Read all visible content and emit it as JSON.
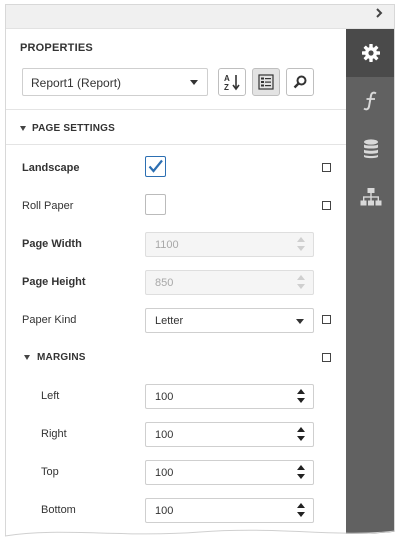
{
  "properties_title": "PROPERTIES",
  "component_selector": {
    "value": "Report1 (Report)"
  },
  "toolbar": {
    "sort_alphabetical_icon": "sort-alphabetical-icon",
    "categorized_icon": "categorized-view-icon",
    "search_icon": "search-icon"
  },
  "page_settings": {
    "header": "PAGE SETTINGS",
    "landscape": {
      "label": "Landscape",
      "checked": true
    },
    "roll_paper": {
      "label": "Roll Paper",
      "checked": false
    },
    "page_width": {
      "label": "Page Width",
      "value": "1100"
    },
    "page_height": {
      "label": "Page Height",
      "value": "850"
    },
    "paper_kind": {
      "label": "Paper Kind",
      "value": "Letter"
    }
  },
  "margins": {
    "header": "MARGINS",
    "left": {
      "label": "Left",
      "value": "100"
    },
    "right": {
      "label": "Right",
      "value": "100"
    },
    "top": {
      "label": "Top",
      "value": "100"
    },
    "bottom": {
      "label": "Bottom",
      "value": "100"
    }
  },
  "side_tabs": [
    "properties-gear-icon",
    "expressions-function-icon",
    "field-list-database-icon",
    "report-explorer-tree-icon"
  ],
  "colors": {
    "sidebar": "#616161",
    "sidebar_active": "#4a4a4a",
    "checkbox_accent": "#2c6fb2"
  }
}
